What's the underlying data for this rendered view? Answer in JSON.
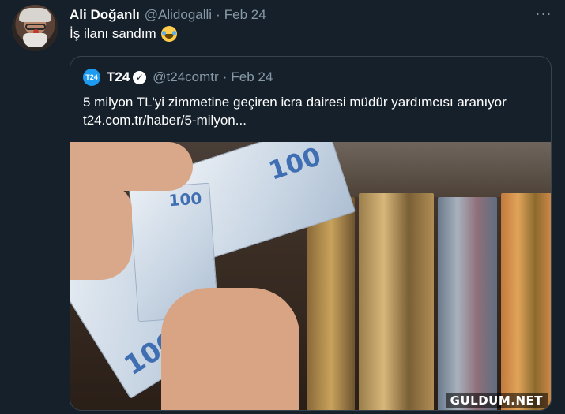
{
  "tweet": {
    "author_name": "Ali Doğanlı",
    "author_handle": "@Alidogalli",
    "separator": "·",
    "date": "Feb 24",
    "text": "İş ilanı sandım",
    "emoji": "face-with-tears-of-joy",
    "more_label": "···"
  },
  "quoted": {
    "logo_text": "T24",
    "name": "T24",
    "handle": "@t24comtr",
    "separator": "·",
    "date": "Feb 24",
    "text_line1": "5 milyon TL'yi zimmetine geçiren icra dairesi müdür yardımcısı aranıyor",
    "text_line2": "t24.com.tr/haber/5-milyon...",
    "banknote_value": "100"
  },
  "watermark": "GULDUM.NET",
  "colors": {
    "background": "#15202b",
    "secondary_text": "#8899a6",
    "border": "#38444d",
    "accent": "#1d9bf0"
  }
}
